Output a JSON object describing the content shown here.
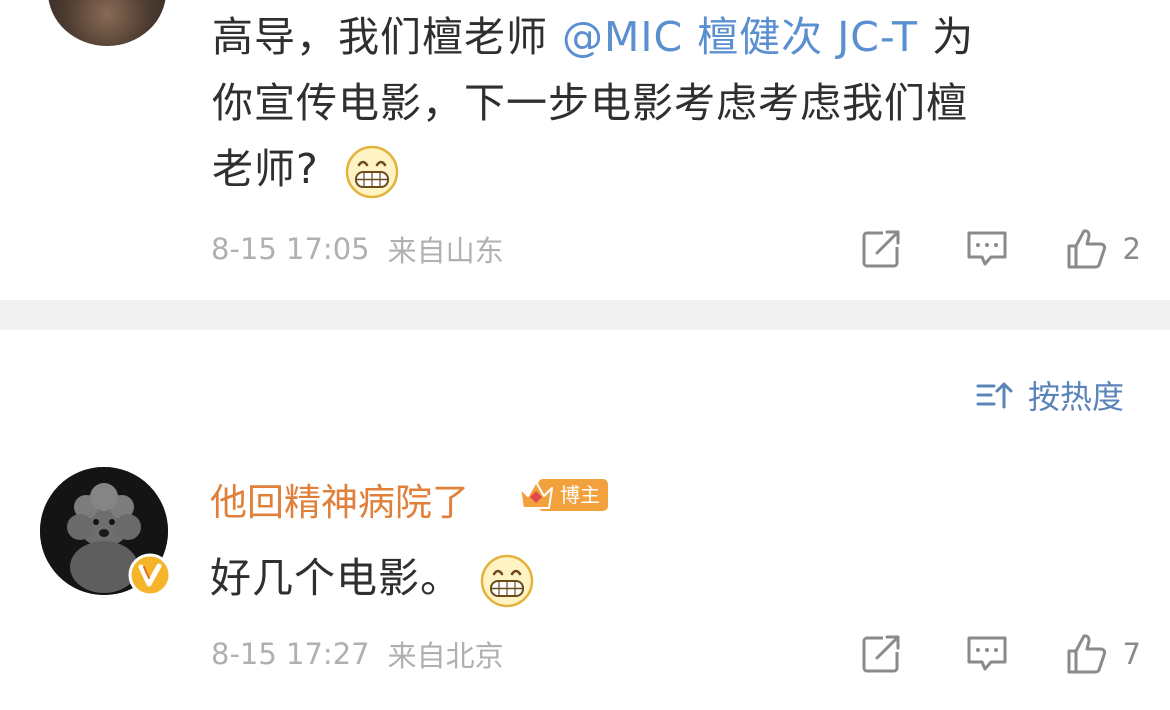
{
  "comment_top": {
    "text_line1_pre": "高导，我们檀老师",
    "mention": "@MIC 檀健次 JC-T",
    "text_line1_post": "为",
    "text_line2": "你宣传电影，下一步电影考虑考虑我们檀",
    "text_line3": "老师?",
    "emoji": "grinning-emoji",
    "time": "8-15 17:05",
    "location": "来自山东",
    "like_count": "2"
  },
  "sort": {
    "icon": "sort-icon",
    "label": "按热度"
  },
  "comment_second": {
    "username": "他回精神病院了",
    "badge_label": "博主",
    "text": "好几个电影。",
    "emoji": "grinning-emoji",
    "time": "8-15 17:27",
    "location": "来自北京",
    "like_count": "7"
  },
  "colors": {
    "mention": "#5a8fd0",
    "username": "#e0803a",
    "badge": "#f2a13c",
    "meta": "#b0b0b0",
    "sort": "#5b84b8",
    "divider": "#f1f1f1"
  }
}
